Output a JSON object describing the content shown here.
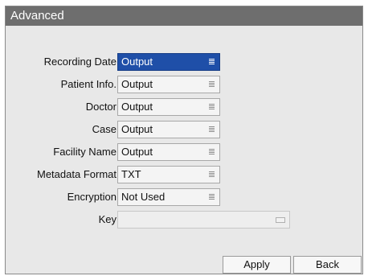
{
  "window": {
    "title": "Advanced"
  },
  "fields": [
    {
      "label": "Recording Date",
      "value": "Output"
    },
    {
      "label": "Patient Info.",
      "value": "Output"
    },
    {
      "label": "Doctor",
      "value": "Output"
    },
    {
      "label": "Case",
      "value": "Output"
    },
    {
      "label": "Facility Name",
      "value": "Output"
    },
    {
      "label": "Metadata Format",
      "value": "TXT"
    },
    {
      "label": "Encryption",
      "value": "Not Used"
    }
  ],
  "key": {
    "label": "Key",
    "value": ""
  },
  "buttons": {
    "apply": "Apply",
    "back": "Back"
  },
  "colors": {
    "titlebar": "#6e6e6e",
    "selected": "#1f4fa8",
    "panel": "#e8e8e8"
  },
  "icons": {
    "dropdown": "list-icon",
    "keyboard": "keyboard-icon"
  }
}
